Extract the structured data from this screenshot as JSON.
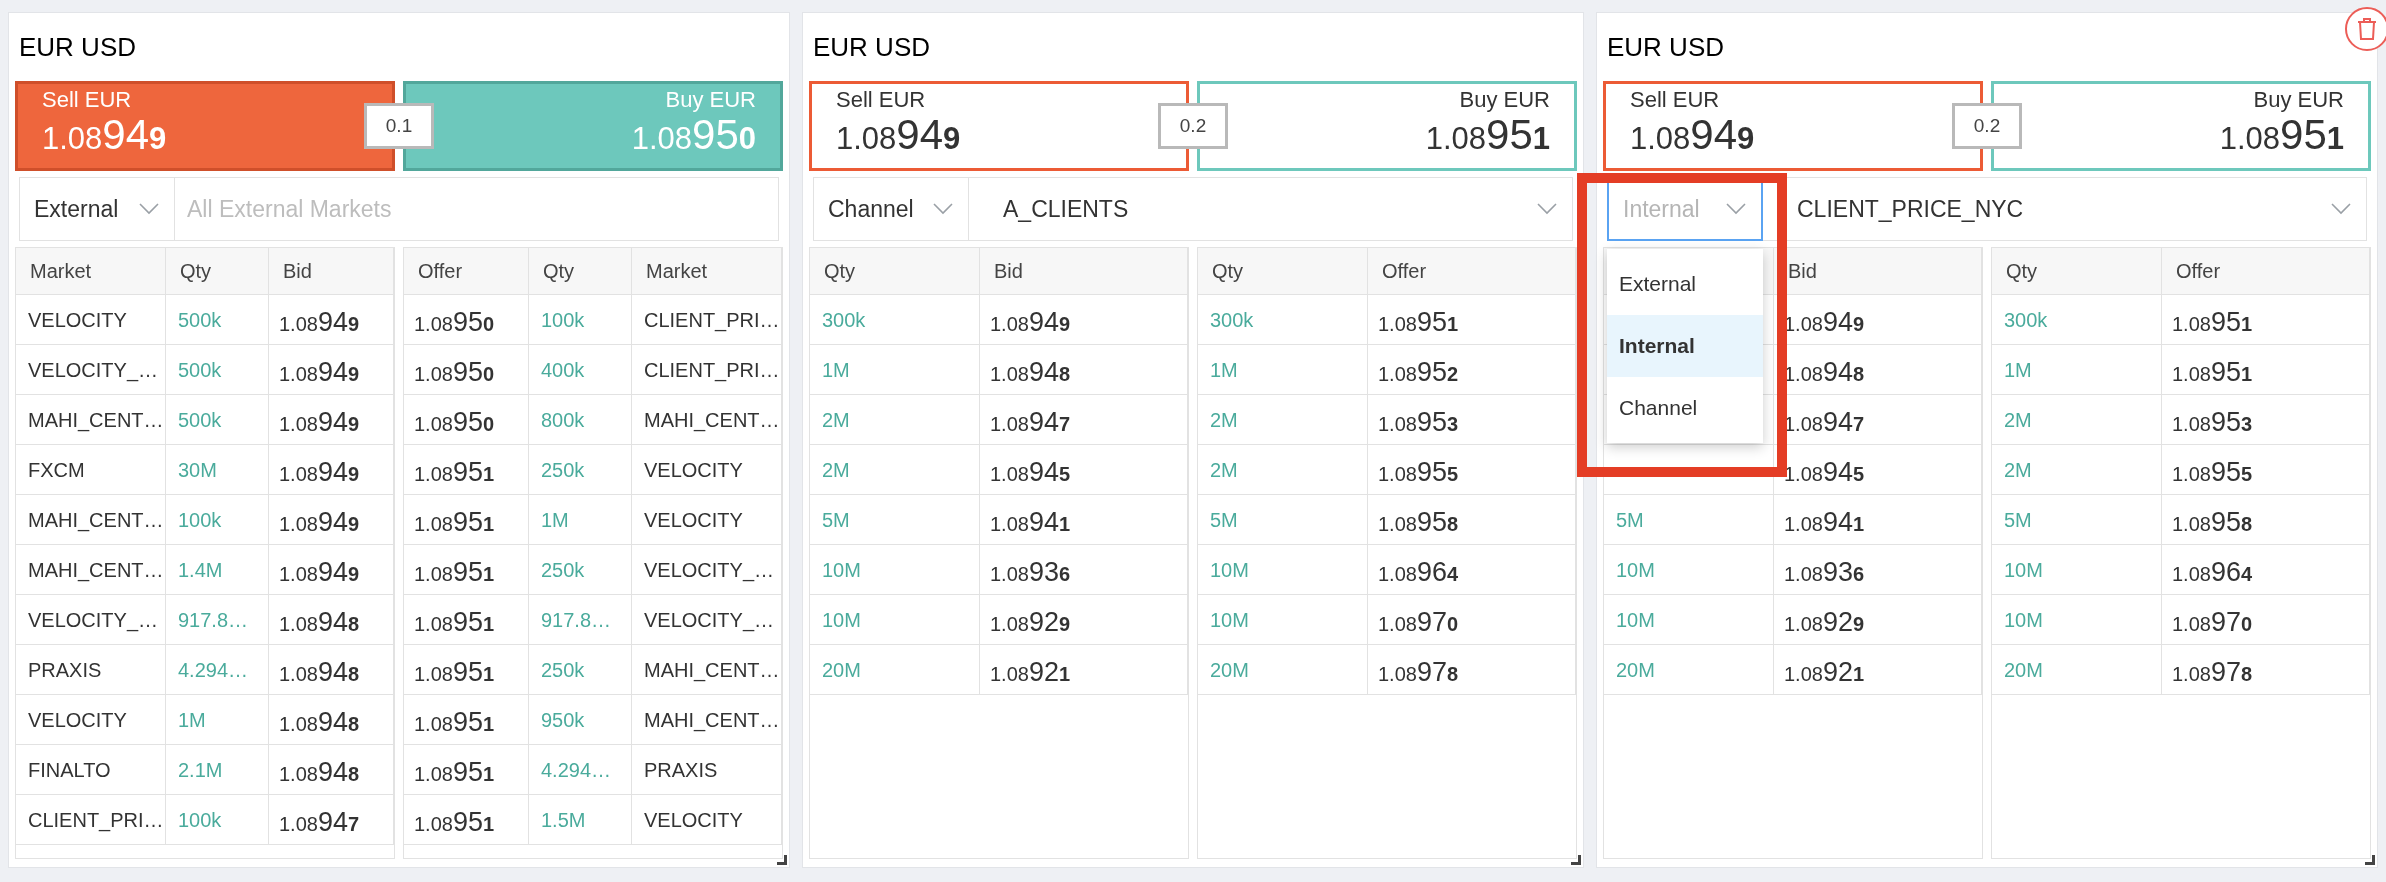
{
  "panels": [
    {
      "title": "EUR USD",
      "filled": true,
      "spread": "0.1",
      "sell": {
        "label": "Sell EUR",
        "price": {
          "lead": "1.08",
          "big": "94",
          "pip": "9"
        }
      },
      "buy": {
        "label": "Buy EUR",
        "price": {
          "lead": "1.08",
          "big": "95",
          "pip": "0"
        }
      },
      "source": {
        "value": "External",
        "focused": false
      },
      "market": {
        "kind": "search",
        "placeholder": "All External Markets"
      },
      "bid_table": {
        "columns": [
          {
            "kind": "market",
            "label": "Market"
          },
          {
            "kind": "qty",
            "label": "Qty"
          },
          {
            "kind": "price",
            "label": "Bid"
          }
        ],
        "rows": [
          {
            "market": "VELOCITY",
            "qty": "500k",
            "price": {
              "lead": "1.08",
              "big": "94",
              "pip": "9"
            }
          },
          {
            "market": "VELOCITY_…",
            "qty": "500k",
            "price": {
              "lead": "1.08",
              "big": "94",
              "pip": "9"
            }
          },
          {
            "market": "MAHI_CENT…",
            "qty": "500k",
            "price": {
              "lead": "1.08",
              "big": "94",
              "pip": "9"
            }
          },
          {
            "market": "FXCM",
            "qty": "30M",
            "price": {
              "lead": "1.08",
              "big": "94",
              "pip": "9"
            }
          },
          {
            "market": "MAHI_CENT…",
            "qty": "100k",
            "price": {
              "lead": "1.08",
              "big": "94",
              "pip": "9"
            }
          },
          {
            "market": "MAHI_CENT…",
            "qty": "1.4M",
            "price": {
              "lead": "1.08",
              "big": "94",
              "pip": "9"
            }
          },
          {
            "market": "VELOCITY_…",
            "qty": "917.8…",
            "price": {
              "lead": "1.08",
              "big": "94",
              "pip": "8"
            }
          },
          {
            "market": "PRAXIS",
            "qty": "4.294…",
            "price": {
              "lead": "1.08",
              "big": "94",
              "pip": "8"
            }
          },
          {
            "market": "VELOCITY",
            "qty": "1M",
            "price": {
              "lead": "1.08",
              "big": "94",
              "pip": "8"
            }
          },
          {
            "market": "FINALTO",
            "qty": "2.1M",
            "price": {
              "lead": "1.08",
              "big": "94",
              "pip": "8"
            }
          },
          {
            "market": "CLIENT_PRI…",
            "qty": "100k",
            "price": {
              "lead": "1.08",
              "big": "94",
              "pip": "7"
            }
          }
        ]
      },
      "offer_table": {
        "columns": [
          {
            "kind": "price",
            "label": "Offer"
          },
          {
            "kind": "qty",
            "label": "Qty"
          },
          {
            "kind": "market",
            "label": "Market"
          }
        ],
        "rows": [
          {
            "market": "CLIENT_PRI…",
            "qty": "100k",
            "price": {
              "lead": "1.08",
              "big": "95",
              "pip": "0"
            }
          },
          {
            "market": "CLIENT_PRI…",
            "qty": "400k",
            "price": {
              "lead": "1.08",
              "big": "95",
              "pip": "0"
            }
          },
          {
            "market": "MAHI_CENT…",
            "qty": "800k",
            "price": {
              "lead": "1.08",
              "big": "95",
              "pip": "0"
            }
          },
          {
            "market": "VELOCITY",
            "qty": "250k",
            "price": {
              "lead": "1.08",
              "big": "95",
              "pip": "1"
            }
          },
          {
            "market": "VELOCITY",
            "qty": "1M",
            "price": {
              "lead": "1.08",
              "big": "95",
              "pip": "1"
            }
          },
          {
            "market": "VELOCITY_…",
            "qty": "250k",
            "price": {
              "lead": "1.08",
              "big": "95",
              "pip": "1"
            }
          },
          {
            "market": "VELOCITY_…",
            "qty": "917.8…",
            "price": {
              "lead": "1.08",
              "big": "95",
              "pip": "1"
            }
          },
          {
            "market": "MAHI_CENT…",
            "qty": "250k",
            "price": {
              "lead": "1.08",
              "big": "95",
              "pip": "1"
            }
          },
          {
            "market": "MAHI_CENT…",
            "qty": "950k",
            "price": {
              "lead": "1.08",
              "big": "95",
              "pip": "1"
            }
          },
          {
            "market": "PRAXIS",
            "qty": "4.294…",
            "price": {
              "lead": "1.08",
              "big": "95",
              "pip": "1"
            }
          },
          {
            "market": "VELOCITY",
            "qty": "1.5M",
            "price": {
              "lead": "1.08",
              "big": "95",
              "pip": "1"
            }
          }
        ]
      }
    },
    {
      "title": "EUR USD",
      "filled": false,
      "spread": "0.2",
      "sell": {
        "label": "Sell EUR",
        "price": {
          "lead": "1.08",
          "big": "94",
          "pip": "9"
        }
      },
      "buy": {
        "label": "Buy EUR",
        "price": {
          "lead": "1.08",
          "big": "95",
          "pip": "1"
        }
      },
      "source": {
        "value": "Channel",
        "focused": false
      },
      "market": {
        "kind": "select",
        "value": "A_CLIENTS"
      },
      "bid_table": {
        "columns": [
          {
            "kind": "qty",
            "label": "Qty"
          },
          {
            "kind": "price",
            "label": "Bid"
          }
        ],
        "rows": [
          {
            "qty": "300k",
            "price": {
              "lead": "1.08",
              "big": "94",
              "pip": "9"
            }
          },
          {
            "qty": "1M",
            "price": {
              "lead": "1.08",
              "big": "94",
              "pip": "8"
            }
          },
          {
            "qty": "2M",
            "price": {
              "lead": "1.08",
              "big": "94",
              "pip": "7"
            }
          },
          {
            "qty": "2M",
            "price": {
              "lead": "1.08",
              "big": "94",
              "pip": "5"
            }
          },
          {
            "qty": "5M",
            "price": {
              "lead": "1.08",
              "big": "94",
              "pip": "1"
            }
          },
          {
            "qty": "10M",
            "price": {
              "lead": "1.08",
              "big": "93",
              "pip": "6"
            }
          },
          {
            "qty": "10M",
            "price": {
              "lead": "1.08",
              "big": "92",
              "pip": "9"
            }
          },
          {
            "qty": "20M",
            "price": {
              "lead": "1.08",
              "big": "92",
              "pip": "1"
            }
          }
        ]
      },
      "offer_table": {
        "columns": [
          {
            "kind": "qty",
            "label": "Qty"
          },
          {
            "kind": "price",
            "label": "Offer"
          }
        ],
        "rows": [
          {
            "qty": "300k",
            "price": {
              "lead": "1.08",
              "big": "95",
              "pip": "1"
            }
          },
          {
            "qty": "1M",
            "price": {
              "lead": "1.08",
              "big": "95",
              "pip": "2"
            }
          },
          {
            "qty": "2M",
            "price": {
              "lead": "1.08",
              "big": "95",
              "pip": "3"
            }
          },
          {
            "qty": "2M",
            "price": {
              "lead": "1.08",
              "big": "95",
              "pip": "5"
            }
          },
          {
            "qty": "5M",
            "price": {
              "lead": "1.08",
              "big": "95",
              "pip": "8"
            }
          },
          {
            "qty": "10M",
            "price": {
              "lead": "1.08",
              "big": "96",
              "pip": "4"
            }
          },
          {
            "qty": "10M",
            "price": {
              "lead": "1.08",
              "big": "97",
              "pip": "0"
            }
          },
          {
            "qty": "20M",
            "price": {
              "lead": "1.08",
              "big": "97",
              "pip": "8"
            }
          }
        ]
      }
    },
    {
      "title": "EUR USD",
      "filled": false,
      "spread": "0.2",
      "delete_button": true,
      "sell": {
        "label": "Sell EUR",
        "price": {
          "lead": "1.08",
          "big": "94",
          "pip": "9"
        }
      },
      "buy": {
        "label": "Buy EUR",
        "price": {
          "lead": "1.08",
          "big": "95",
          "pip": "1"
        }
      },
      "source": {
        "value": "Internal",
        "focused": true,
        "highlighted": true,
        "options": [
          {
            "label": "External",
            "selected": false
          },
          {
            "label": "Internal",
            "selected": true
          },
          {
            "label": "Channel",
            "selected": false
          }
        ]
      },
      "market": {
        "kind": "select",
        "value": "CLIENT_PRICE_NYC"
      },
      "bid_table": {
        "columns": [
          {
            "kind": "qty"
          },
          {
            "kind": "price",
            "label": "Bid"
          }
        ],
        "rows": [
          {
            "price": {
              "lead": "1.08",
              "big": "94",
              "pip": "9"
            }
          },
          {
            "price": {
              "lead": "1.08",
              "big": "94",
              "pip": "8"
            }
          },
          {
            "price": {
              "lead": "1.08",
              "big": "94",
              "pip": "7"
            }
          },
          {
            "price": {
              "lead": "1.08",
              "big": "94",
              "pip": "5"
            }
          },
          {
            "qty": "5M",
            "price": {
              "lead": "1.08",
              "big": "94",
              "pip": "1"
            }
          },
          {
            "qty": "10M",
            "price": {
              "lead": "1.08",
              "big": "93",
              "pip": "6"
            }
          },
          {
            "qty": "10M",
            "price": {
              "lead": "1.08",
              "big": "92",
              "pip": "9"
            }
          },
          {
            "qty": "20M",
            "price": {
              "lead": "1.08",
              "big": "92",
              "pip": "1"
            }
          }
        ]
      },
      "offer_table": {
        "columns": [
          {
            "kind": "qty",
            "label": "Qty"
          },
          {
            "kind": "price",
            "label": "Offer"
          }
        ],
        "rows": [
          {
            "qty": "300k",
            "price": {
              "lead": "1.08",
              "big": "95",
              "pip": "1"
            }
          },
          {
            "qty": "1M",
            "price": {
              "lead": "1.08",
              "big": "95",
              "pip": "1"
            }
          },
          {
            "qty": "2M",
            "price": {
              "lead": "1.08",
              "big": "95",
              "pip": "3"
            }
          },
          {
            "qty": "2M",
            "price": {
              "lead": "1.08",
              "big": "95",
              "pip": "5"
            }
          },
          {
            "qty": "5M",
            "price": {
              "lead": "1.08",
              "big": "95",
              "pip": "8"
            }
          },
          {
            "qty": "10M",
            "price": {
              "lead": "1.08",
              "big": "96",
              "pip": "4"
            }
          },
          {
            "qty": "10M",
            "price": {
              "lead": "1.08",
              "big": "97",
              "pip": "0"
            }
          },
          {
            "qty": "20M",
            "price": {
              "lead": "1.08",
              "big": "97",
              "pip": "8"
            }
          }
        ]
      }
    }
  ]
}
